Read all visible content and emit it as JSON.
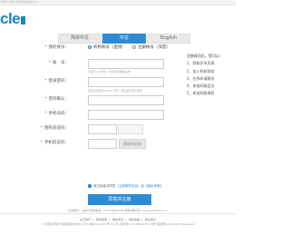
{
  "topbar": {
    "text": "中国科学院计算机网络信息中心"
  },
  "logo": {
    "text": "cle"
  },
  "tabs": [
    {
      "label": "简体中文",
      "active": false
    },
    {
      "label": "中文",
      "active": true
    },
    {
      "label": "English",
      "active": false
    }
  ],
  "form": {
    "type": {
      "label": "我的身份：",
      "options": [
        "机构账号（直接）",
        "注册帐号（深度）"
      ],
      "selected": 0
    },
    "account": {
      "label": "账　号：",
      "hint": "长度不少于6位，建议使用邮箱注册"
    },
    "password": {
      "label": "登录密码：",
      "hint": "密码长度需为8-20个字符，需包含字母与数字"
    },
    "confirm": {
      "label": "密码确认："
    },
    "phone": {
      "label": "手机号码："
    },
    "captcha": {
      "label": "图形验证码："
    },
    "sms": {
      "label": "手机验证码：",
      "button": "获取验证码"
    },
    "agree": {
      "prefix": "我已阅读并同意",
      "link1": "《注册服务协议》",
      "middle": "及",
      "link2": "《隐私声明》"
    },
    "submit": "同意并注册"
  },
  "side": {
    "title": "注册成功后，您可以：",
    "items": [
      "1、获取学术资源",
      "2、加入科研群组",
      "3、在线申请服务",
      "4、参加网络会议",
      "5、参加网络课程"
    ]
  },
  "help": "如有疑问，请拨打客服电话：010-58812000 或发送邮件至 support@cstnet.cn",
  "footer": {
    "links": [
      "关于我们",
      "服务指南",
      "服务条款",
      "隐私政策",
      "联系我们"
    ],
    "copyright": "© 中国科学院计算机网络信息中心 京ICP备09112257号-94 京公网安备11010802032138号 版权所有 All Rights Reserved"
  }
}
